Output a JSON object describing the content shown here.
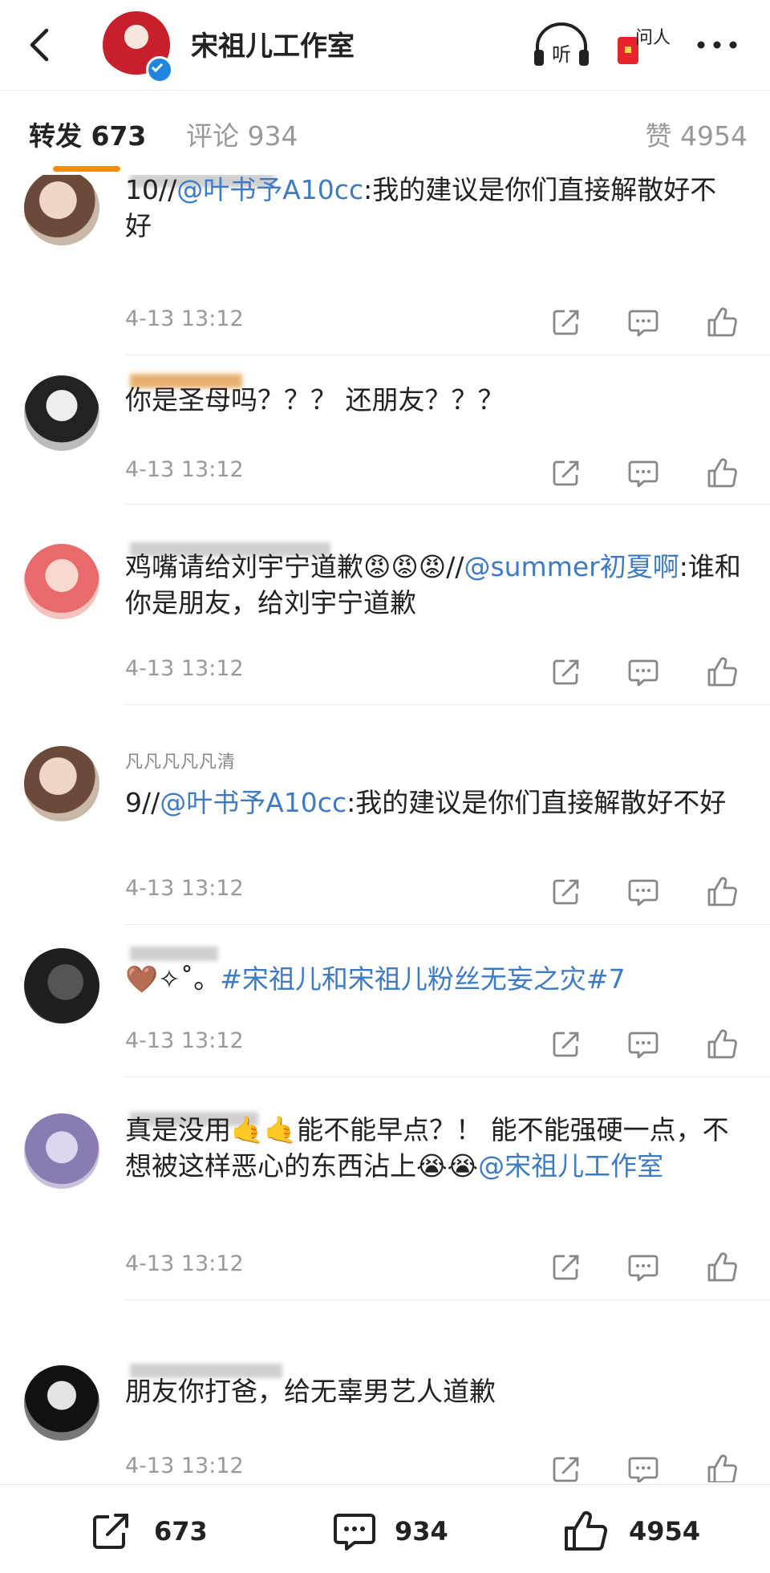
{
  "header": {
    "title": "宋祖儿工作室",
    "listen_label": "听",
    "ask_label": "问人"
  },
  "tabs": {
    "repost": "转发 673",
    "comment": "评论 934",
    "like": "赞 4954"
  },
  "comments": [
    {
      "user": "",
      "text_pre": "10//",
      "mention": "@叶书予A10cc",
      "text_post": ":我的建议是你们直接解散好不好",
      "time": "4-13 13:12"
    },
    {
      "user": "",
      "text_pre": "你是圣母吗？？？ 还朋友？？？",
      "mention": "",
      "text_post": "",
      "time": "4-13 13:12"
    },
    {
      "user": "",
      "text_pre": "鸡嘴请给刘宇宁道歉😡😡😡//",
      "mention": "@summer初夏啊",
      "text_post": ":谁和你是朋友，给刘宇宁道歉",
      "time": "4-13 13:12"
    },
    {
      "user": "凡凡凡凡凡清",
      "text_pre": "9//",
      "mention": "@叶书予A10cc",
      "text_post": ":我的建议是你们直接解散好不好",
      "time": "4-13 13:12"
    },
    {
      "user": "",
      "text_pre": "🤎✧˚。",
      "mention": "#宋祖儿和宋祖儿粉丝无妄之灾#",
      "text_post": "7",
      "time": "4-13 13:12"
    },
    {
      "user": "",
      "text_pre": "真是没用🤙🤙能不能早点？！ 能不能强硬一点，不想被这样恶心的东西沾上😭😭",
      "mention": "@宋祖儿工作室",
      "text_post": "",
      "time": "4-13 13:12"
    },
    {
      "user": "",
      "text_pre": "朋友你打爸，给无辜男艺人道歉",
      "mention": "",
      "text_post": "",
      "time": "4-13 13:12"
    }
  ],
  "bottom": {
    "repost_count": "673",
    "comment_count": "934",
    "like_count": "4954"
  },
  "colors": {
    "accent": "#ff8a00",
    "link": "#3e7bc4",
    "muted": "#999999"
  }
}
